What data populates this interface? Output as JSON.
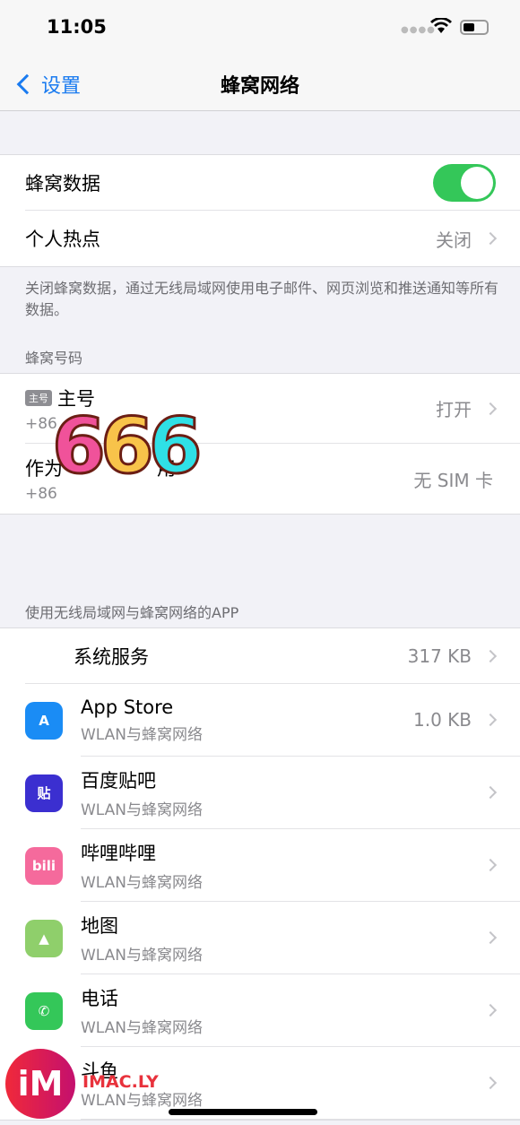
{
  "status": {
    "time": "11:05"
  },
  "nav": {
    "back": "设置",
    "title": "蜂窝网络"
  },
  "cellular": {
    "data_label": "蜂窝数据",
    "data_on": true,
    "hotspot_label": "个人热点",
    "hotspot_value": "关闭"
  },
  "footer": "关闭蜂窝数据，通过无线局域网使用电子邮件、网页浏览和推送通知等所有数据。",
  "numbers": {
    "header": "蜂窝号码",
    "items": [
      {
        "badge": "主号",
        "title": "主号",
        "number": "+86",
        "value": "打开"
      },
      {
        "title": "作为　　　　　用",
        "number": "+86",
        "value": "无 SIM 卡"
      }
    ]
  },
  "sticker": "666",
  "apps": {
    "header": "使用无线局域网与蜂窝网络的APP",
    "system": {
      "label": "系统服务",
      "value": "317 KB"
    },
    "items": [
      {
        "name": "App Store",
        "sub": "WLAN与蜂窝网络",
        "value": "1.0 KB",
        "icon": "app-store",
        "color": "#1a8cf5",
        "glyph": "A"
      },
      {
        "name": "百度贴吧",
        "sub": "WLAN与蜂窝网络",
        "value": "",
        "icon": "tieba",
        "color": "#3b2fd0",
        "glyph": "贴"
      },
      {
        "name": "哔哩哔哩",
        "sub": "WLAN与蜂窝网络",
        "value": "",
        "icon": "bilibili",
        "color": "#f56a9c",
        "glyph": "bili"
      },
      {
        "name": "地图",
        "sub": "WLAN与蜂窝网络",
        "value": "",
        "icon": "maps",
        "color": "#8fcf6b",
        "glyph": "▲"
      },
      {
        "name": "电话",
        "sub": "WLAN与蜂窝网络",
        "value": "",
        "icon": "phone",
        "color": "#34c759",
        "glyph": "✆"
      },
      {
        "name": "斗鱼",
        "sub": "WLAN与蜂窝网络",
        "value": "",
        "icon": "douyu",
        "color": "#ff7a00",
        "glyph": ""
      }
    ]
  },
  "watermark": {
    "logo": "iM",
    "text": "IMAC.LY"
  }
}
